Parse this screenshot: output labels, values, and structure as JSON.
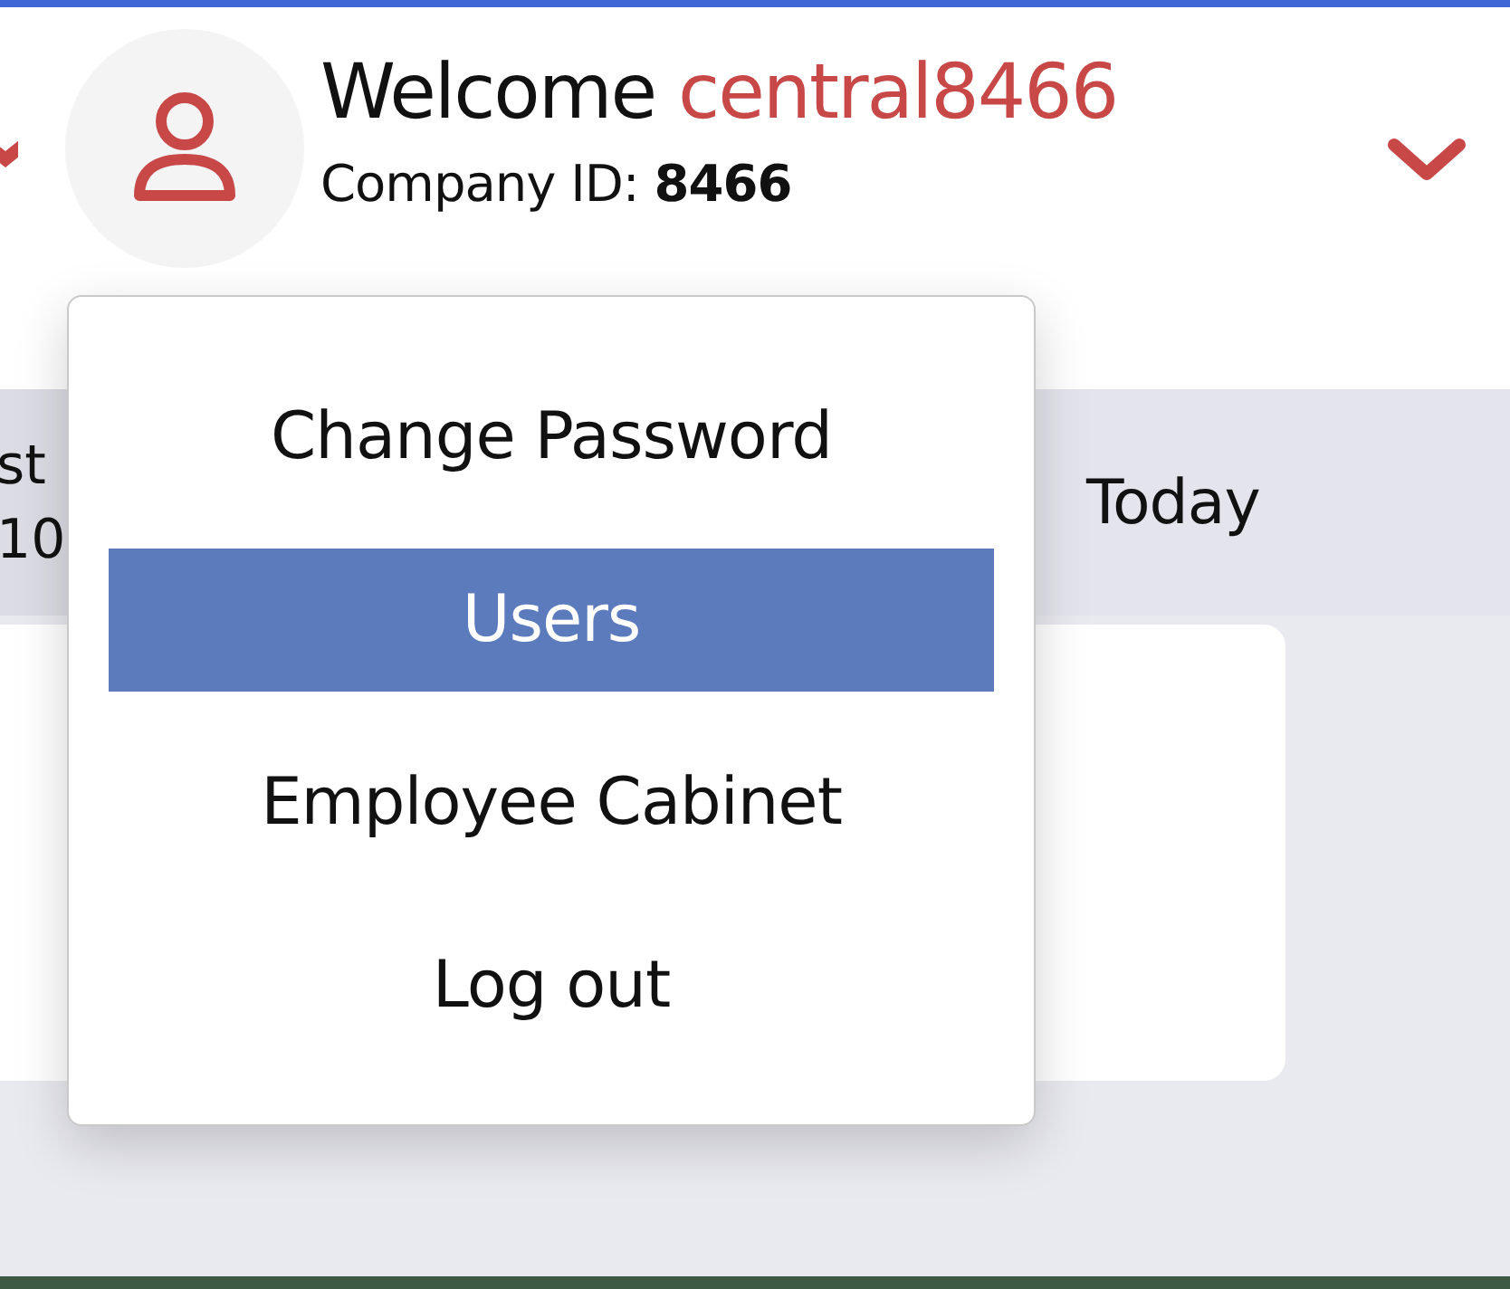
{
  "header": {
    "greeting": "Welcome",
    "username": "central8466",
    "company_label": "Company ID:",
    "company_id": "8466"
  },
  "summary": {
    "column_1": [
      "st",
      "10"
    ],
    "column_2": "Today"
  },
  "menu": {
    "items": [
      {
        "label": "Change Password",
        "selected": false
      },
      {
        "label": "Users",
        "selected": true
      },
      {
        "label": "Employee Cabinet",
        "selected": false
      },
      {
        "label": "Log out",
        "selected": false
      }
    ]
  }
}
